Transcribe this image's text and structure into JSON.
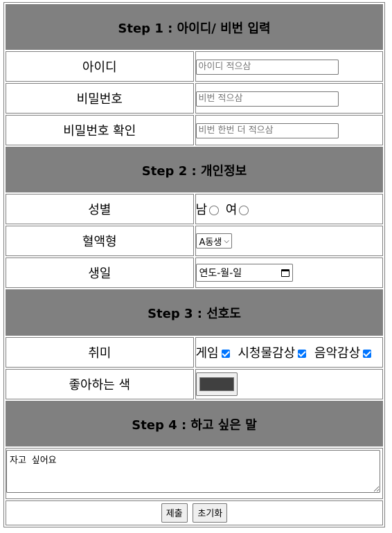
{
  "steps": {
    "step1": "Step 1 : 아이디/ 비번 입력",
    "step2": "Step 2 : 개인정보",
    "step3": "Step 3 : 선호도",
    "step4": "Step 4 : 하고 싶은 말"
  },
  "account": {
    "id_label": "아이디",
    "id_placeholder": "아이디 적으삼",
    "password_label": "비밀번호",
    "password_placeholder": "비번 적으삼",
    "confirm_label": "비밀번호 확인",
    "confirm_placeholder": "비번 한번 더 적으삼"
  },
  "personal": {
    "gender_label": "성별",
    "gender_options": [
      "남",
      "여"
    ],
    "blood_label": "혈액형",
    "blood_selected": "A동생",
    "birthday_label": "생일",
    "birthday_value": "연도-월-일"
  },
  "preferences": {
    "hobby_label": "취미",
    "hobbies": [
      "게임",
      "시청물감상",
      "음악감상"
    ],
    "color_label": "좋아하는 색",
    "color_value": "#404040"
  },
  "message": {
    "textarea_value": "자고 싶어요"
  },
  "buttons": {
    "submit": "제출",
    "reset": "초기화"
  },
  "colors": {
    "header_bg": "#808080",
    "checkbox_accent": "#0075ff"
  }
}
